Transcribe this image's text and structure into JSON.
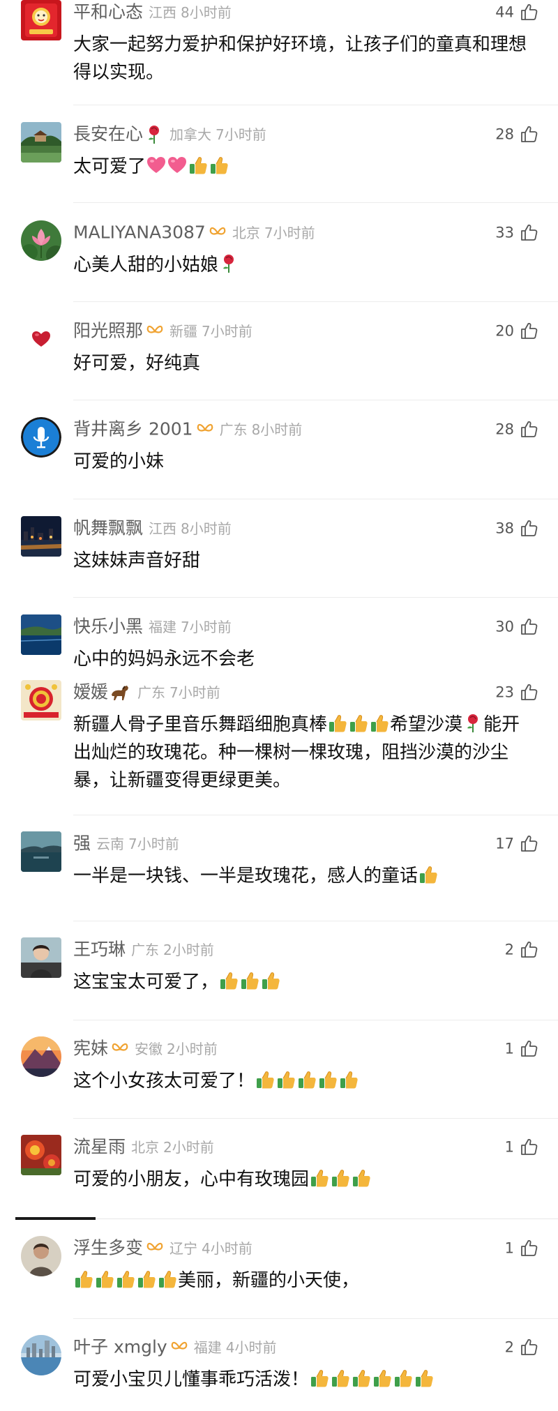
{
  "comments": [
    {
      "user": "平和心态",
      "location": "江西",
      "time": "8小时前",
      "likes": "44",
      "text": "大家一起努力爱护和保护好环境，让孩子们的童真和理想得以实现。",
      "avatar": "red-envelope",
      "shape": "sq"
    },
    {
      "user": "長安在心",
      "user_emoji": "rose",
      "location": "加拿大",
      "time": "7小时前",
      "likes": "28",
      "text": "太可爱了",
      "trail": [
        "heart",
        "heart",
        "thumb",
        "thumb"
      ],
      "avatar": "garden",
      "shape": "sq"
    },
    {
      "user": "MALIYANA3087",
      "badge": true,
      "location": "北京",
      "time": "7小时前",
      "likes": "33",
      "text": "心美人甜的小姑娘",
      "trail": [
        "rose"
      ],
      "avatar": "lotus",
      "shape": "rd"
    },
    {
      "user": "阳光照那",
      "badge": true,
      "location": "新疆",
      "time": "7小时前",
      "likes": "20",
      "text": "好可爱，好纯真",
      "avatar": "heart",
      "shape": "rd"
    },
    {
      "user": "背井离乡 2001",
      "badge": true,
      "location": "广东",
      "time": "8小时前",
      "likes": "28",
      "text": "可爱的小妹",
      "avatar": "mic",
      "shape": "rd"
    },
    {
      "user": "帆舞飘飘",
      "location": "江西",
      "time": "8小时前",
      "likes": "38",
      "text": "这妹妹声音好甜",
      "avatar": "night-city",
      "shape": "sq"
    },
    {
      "user": "快乐小黑",
      "location": "福建",
      "time": "7小时前",
      "likes": "30",
      "text": "心中的妈妈永远不会老",
      "avatar": "coast",
      "shape": "sq"
    },
    {
      "user": "嫒媛",
      "user_emoji": "horse",
      "location": "广东",
      "time": "7小时前",
      "likes": "23",
      "text": "新疆人骨子里音乐舞蹈细胞真棒👍👍👍希望沙漠🥀能开出灿烂的玫瑰花。种一棵树一棵玫瑰，阻挡沙漠的沙尘暴，让新疆变得更绿更美。",
      "avatar": "fortune",
      "shape": "sq"
    },
    {
      "user": "强",
      "location": "云南",
      "time": "7小时前",
      "likes": "17",
      "text": "一半是一块钱、一半是玫瑰花，感人的童话",
      "trail": [
        "thumb"
      ],
      "avatar": "lake",
      "shape": "sq"
    },
    {
      "user": "王巧琳",
      "location": "广东",
      "time": "2小时前",
      "likes": "2",
      "text": "这宝宝太可爱了，",
      "trail": [
        "thumb",
        "thumb",
        "thumb"
      ],
      "avatar": "portrait",
      "shape": "sq"
    },
    {
      "user": "宪妹",
      "badge": true,
      "location": "安徽",
      "time": "2小时前",
      "likes": "1",
      "text": "这个小女孩太可爱了！",
      "trail": [
        "thumb",
        "thumb",
        "thumb",
        "thumb",
        "thumb"
      ],
      "avatar": "mountain",
      "shape": "rd"
    },
    {
      "user": "流星雨",
      "location": "北京",
      "time": "2小时前",
      "likes": "1",
      "text": "可爱的小朋友，心中有玫瑰园",
      "trail": [
        "thumb",
        "thumb",
        "thumb"
      ],
      "avatar": "flower",
      "shape": "sq"
    },
    {
      "user": "浮生多变",
      "badge": true,
      "location": "辽宁",
      "time": "4小时前",
      "likes": "1",
      "text": "美丽，新疆的小天使，",
      "lead": [
        "thumb",
        "thumb",
        "thumb",
        "thumb",
        "thumb"
      ],
      "avatar": "person",
      "shape": "rd"
    },
    {
      "user": "叶子 xmgly",
      "badge": true,
      "location": "福建",
      "time": "4小时前",
      "likes": "2",
      "text": "可爱小宝贝儿懂事乖巧活泼！",
      "trail": [
        "thumb",
        "thumb",
        "thumb",
        "thumb",
        "thumb",
        "thumb"
      ],
      "avatar": "harbor",
      "shape": "rd"
    }
  ]
}
